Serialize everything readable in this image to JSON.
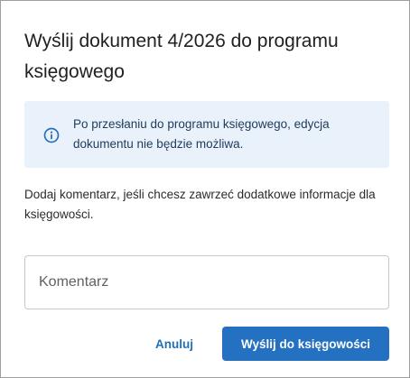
{
  "dialog": {
    "title": "Wyślij dokument 4/2026 do programu księgowego",
    "alert": {
      "icon": "info-circle-icon",
      "text": "Po przesłaniu do programu księgowego, edycja dokumentu nie będzie możliwa."
    },
    "hint": "Dodaj komentarz, jeśli chcesz zawrzeć dodatkowe informacje dla księgowości.",
    "comment_field": {
      "placeholder": "Komentarz",
      "value": ""
    },
    "cancel_label": "Anuluj",
    "send_label": "Wyślij do księgowości"
  },
  "colors": {
    "accent": "#2571c1",
    "alert_background": "#e9f2fb",
    "link": "#1f6fb8"
  }
}
